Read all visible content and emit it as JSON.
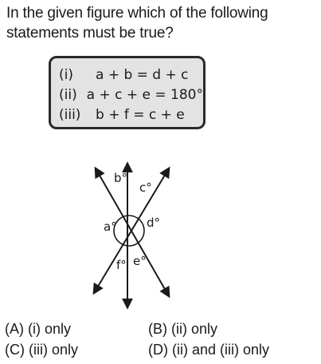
{
  "question": {
    "line1": "In the given figure which of the following",
    "line2": "statements must be true?"
  },
  "statements": [
    {
      "num": "(i)",
      "text": "a + b = d + c"
    },
    {
      "num": "(ii)",
      "text": "a + c + e = 180°"
    },
    {
      "num": "(iii)",
      "text": "b + f = c + e"
    }
  ],
  "figure": {
    "labels": {
      "a": "a°",
      "b": "b°",
      "c": "c°",
      "d": "d°",
      "e": "e°",
      "f": "f°"
    }
  },
  "options": {
    "A": "(A)  (i) only",
    "B": "(B)  (ii) only",
    "C": "(C)  (iii) only",
    "D": "(D)  (ii) and (iii) only"
  }
}
